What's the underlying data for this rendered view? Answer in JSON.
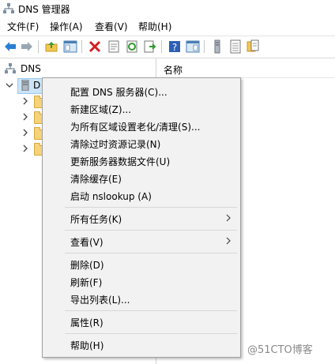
{
  "window": {
    "title": "DNS 管理器"
  },
  "menubar": {
    "items": [
      "文件(F)",
      "操作(A)",
      "查看(V)",
      "帮助(H)"
    ]
  },
  "toolbar": {
    "buttons": [
      "back-icon",
      "forward-icon",
      "up-folder-icon",
      "show-hide-tree-icon",
      "delete-icon",
      "properties-icon",
      "refresh-icon",
      "export-list-icon",
      "help-icon",
      "action-pane-icon",
      "server-icon",
      "records-icon",
      "zone-icon"
    ]
  },
  "tree": {
    "root_label": "DNS",
    "server_label": "D",
    "child_count": 4
  },
  "list": {
    "column_name": "名称"
  },
  "context_menu": {
    "items": [
      "配置 DNS 服务器(C)...",
      "新建区域(Z)...",
      "为所有区域设置老化/清理(S)...",
      "清除过时资源记录(N)",
      "更新服务器数据文件(U)",
      "清除缓存(E)",
      "启动 nslookup (A)",
      "所有任务(K)",
      "查看(V)",
      "删除(D)",
      "刷新(F)",
      "导出列表(L)...",
      "属性(R)",
      "帮助(H)"
    ]
  },
  "watermark": "@51CTO博客"
}
